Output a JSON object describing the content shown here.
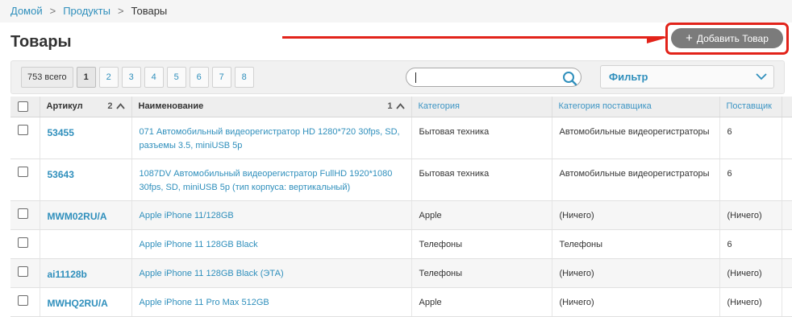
{
  "breadcrumb": {
    "home": "Домой",
    "products": "Продукты",
    "current": "Товары",
    "separator": ">"
  },
  "page": {
    "title": "Товары"
  },
  "actions": {
    "add_product": "Добавить Товар",
    "add_icon": "+"
  },
  "pager": {
    "total": "753 всего",
    "pages": [
      "1",
      "2",
      "3",
      "4",
      "5",
      "6",
      "7",
      "8"
    ],
    "active_page": "1"
  },
  "search": {
    "value": "",
    "placeholder": ""
  },
  "filter": {
    "label": "Фильтр"
  },
  "table": {
    "columns": {
      "article": "Артикул",
      "article_sort_index": "2",
      "name": "Наименование",
      "name_sort_index": "1",
      "category": "Категория",
      "supplier_category": "Категория поставщика",
      "supplier": "Поставщик"
    },
    "rows": [
      {
        "article": "53455",
        "name": "071 Автомобильный видеорегистратор HD 1280*720 30fps, SD, разъемы 3.5, miniUSB 5p",
        "category": "Бытовая техника",
        "supplier_category": "Автомобильные видеорегистраторы",
        "supplier": "6"
      },
      {
        "article": "53643",
        "name": "1087DV Автомобильный видеорегистратор FullHD 1920*1080 30fps, SD, miniUSB 5p (тип корпуса: вертикальный)",
        "category": "Бытовая техника",
        "supplier_category": "Автомобильные видеорегистраторы",
        "supplier": "6"
      },
      {
        "article": "MWM02RU/A",
        "name": "Apple iPhone 11/128GB",
        "category": "Apple",
        "supplier_category": "(Ничего)",
        "supplier": "(Ничего)"
      },
      {
        "article": "",
        "name": "Apple iPhone 11 128GB Black",
        "category": "Телефоны",
        "supplier_category": "Телефоны",
        "supplier": "6"
      },
      {
        "article": "ai11128b",
        "name": "Apple iPhone 11 128GB Black (ЭТА)",
        "category": "Телефоны",
        "supplier_category": "(Ничего)",
        "supplier": "(Ничего)"
      },
      {
        "article": "MWHQ2RU/A",
        "name": "Apple iPhone 11 Pro Max 512GB",
        "category": "Apple",
        "supplier_category": "(Ничего)",
        "supplier": "(Ничего)"
      }
    ]
  },
  "colors": {
    "link": "#2f8fbc",
    "annotation_red": "#e2231a",
    "button_gray": "#7b7b7b"
  },
  "icons": {
    "search": "search-icon",
    "filter": "chevron-down-icon",
    "sort": "chevron-up-icon"
  }
}
